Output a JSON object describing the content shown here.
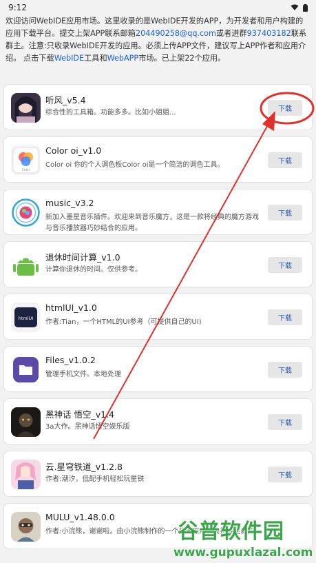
{
  "status": {
    "time": "9:12"
  },
  "intro": {
    "part1": "欢迎访问WebIDE应用市场。这里收录的是WebIDE开发的APP，为开发者和用户构建的应用下载平台。提交上架APP联系邮箱",
    "email": "204490258@qq.com",
    "part2": "或者进群",
    "group": "937403182",
    "part3": "联系群主。注意:只收录WebIDE开发的应用。必须上传APP文件，建议写上APP作者和应用介绍。 点击下载",
    "webide": "WebIDE",
    "part4": "工具和",
    "webapp": "WebAPP",
    "part5": "市场。已上架22个应用。"
  },
  "apps": [
    {
      "title": "听风_v5.4",
      "desc": "综合性的工具箱。功能多多。比如小姐姐...",
      "button": "下载"
    },
    {
      "title": "Color oi_v1.0",
      "desc": "Color oi 你的个人调色板Color oi是一个简洁的调色工具。",
      "button": "下载",
      "icon_label": "Color"
    },
    {
      "title": "music_v3.2",
      "desc": "新加入墨星音乐插件。欢迎来到音乐魔方，这是一款将经典的魔方游戏与音乐播放器巧妙结合的应用。",
      "button": "下载"
    },
    {
      "title": "退休时间计算_v1.0",
      "desc": "计算你退休的时间。仅供参考。",
      "button": "下载"
    },
    {
      "title": "htmlUI_v1.0",
      "desc": "作者:Tian，一个HTML的UI参考（可提供自己的UI)",
      "button": "下载",
      "icon_label": "htmlUI"
    },
    {
      "title": "Files_v1.0.2",
      "desc": "管理手机文件。本地处理",
      "button": "下载"
    },
    {
      "title": "黑神话 悟空_v1.4",
      "desc": "3a大作。黑神话悟空娱乐版",
      "button": "下载"
    },
    {
      "title": "云.星穹铁道_v1.2.8",
      "desc": "作者:潮汐，低配手机轻松玩星铁",
      "button": "下载"
    },
    {
      "title": "MULU_v1.48.0.0",
      "desc": "作者:小浣熊，谢谢啦。由小浣熊制作的一个目录应用，会持续更新的",
      "button": "下载"
    }
  ],
  "watermark": {
    "name": "谷普软件园",
    "url": "www.gupuxlazal.com"
  },
  "colors": {
    "link": "#1a5fd6",
    "annotation": "#e0302a",
    "watermark": "#3aa64a"
  }
}
